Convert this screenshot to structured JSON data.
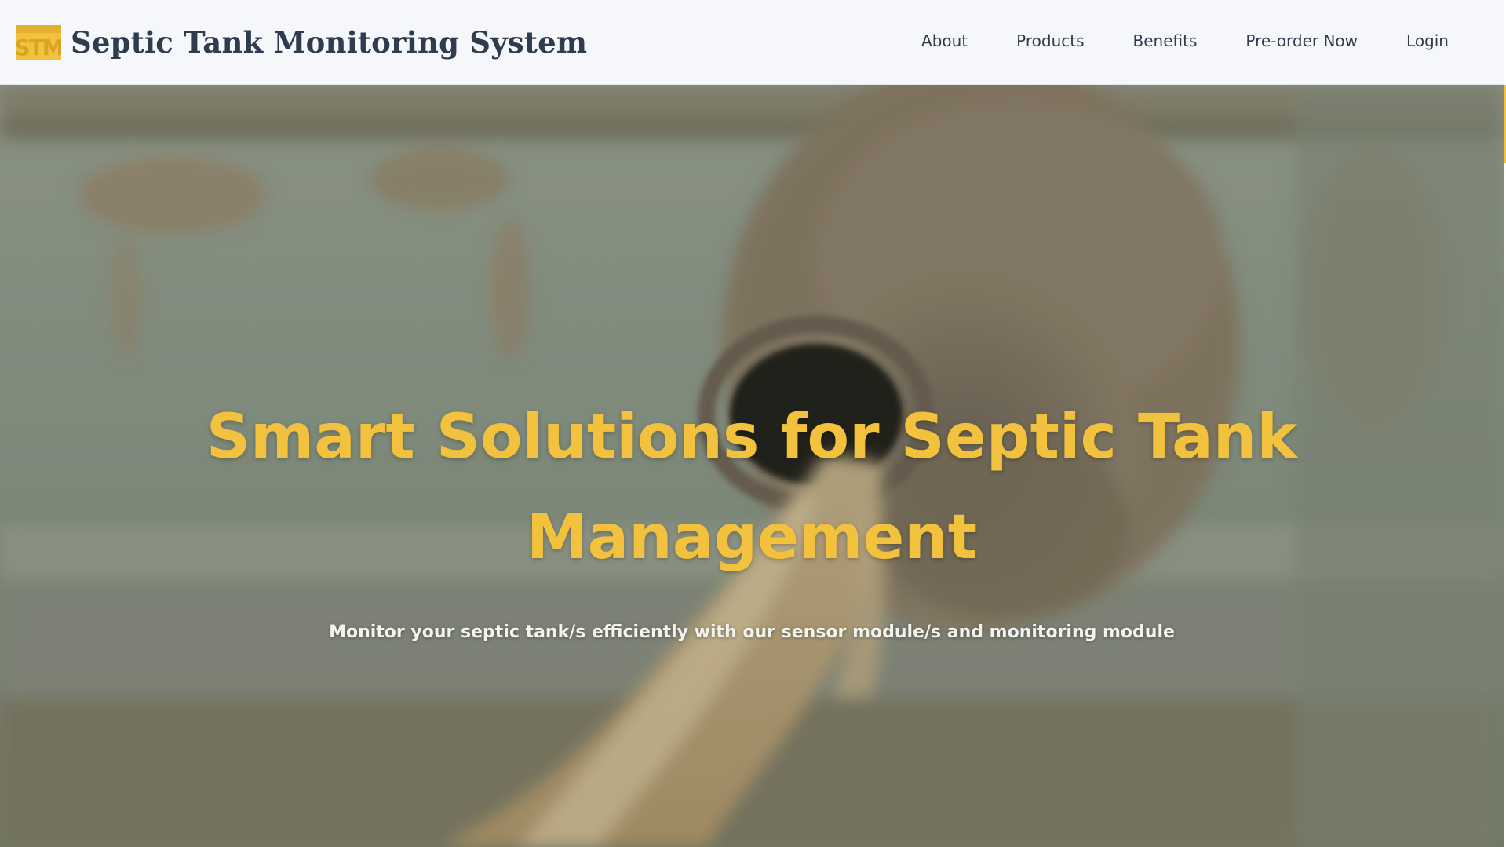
{
  "header": {
    "logo_text": "STM",
    "title": "Septic Tank Monitoring System",
    "nav": [
      {
        "label": "About"
      },
      {
        "label": "Products"
      },
      {
        "label": "Benefits"
      },
      {
        "label": "Pre-order Now"
      },
      {
        "label": "Login"
      }
    ]
  },
  "hero": {
    "title": "Smart Solutions for Septic Tank Management",
    "subtitle": "Monitor your septic tank/s efficiently with our sensor module/s and monitoring module",
    "background_icon": "septic-tank-outflow-photo"
  },
  "colors": {
    "accent": "#f2c23e",
    "nav_bg": "#f5f7fb",
    "nav_text": "#2f3b4e",
    "subtitle": "#f3f3f0"
  }
}
